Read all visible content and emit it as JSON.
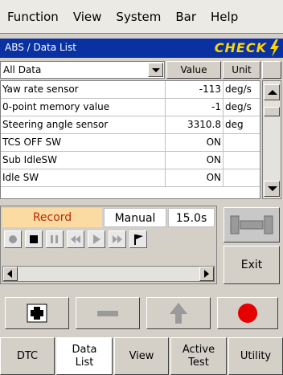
{
  "menu": [
    "Function",
    "View",
    "System",
    "Bar",
    "Help"
  ],
  "title": {
    "text": "ABS / Data List",
    "badge": "CHECK"
  },
  "filter": {
    "selected": "All Data"
  },
  "columns": {
    "value": "Value",
    "unit": "Unit"
  },
  "rows": [
    {
      "name": "Yaw rate sensor",
      "value": "-113",
      "unit": "deg/s"
    },
    {
      "name": "0-point memory value",
      "value": "-1",
      "unit": "deg/s"
    },
    {
      "name": "Steering angle sensor",
      "value": "3310.8",
      "unit": "deg"
    },
    {
      "name": "TCS OFF SW",
      "value": "ON",
      "unit": ""
    },
    {
      "name": "Sub IdleSW",
      "value": "ON",
      "unit": ""
    },
    {
      "name": "Idle SW",
      "value": "ON",
      "unit": ""
    }
  ],
  "record": {
    "label": "Record",
    "mode": "Manual",
    "time": "15.0s"
  },
  "exit_label": "Exit",
  "tabs": [
    {
      "line1": "DTC",
      "line2": ""
    },
    {
      "line1": "Data",
      "line2": "List"
    },
    {
      "line1": "View",
      "line2": ""
    },
    {
      "line1": "Active",
      "line2": "Test"
    },
    {
      "line1": "Utility",
      "line2": ""
    }
  ],
  "icons": {
    "record_dot": "red-circle-icon",
    "tool": "wrench-icon",
    "add": "plus-icon",
    "remove": "minus-icon",
    "up": "up-arrow-icon"
  },
  "colors": {
    "title_bg": "#0a31a2",
    "badge": "#ffd400",
    "record_bg": "#fcdba2",
    "record_text": "#ba2b04",
    "rec_dot": "#e60000"
  }
}
